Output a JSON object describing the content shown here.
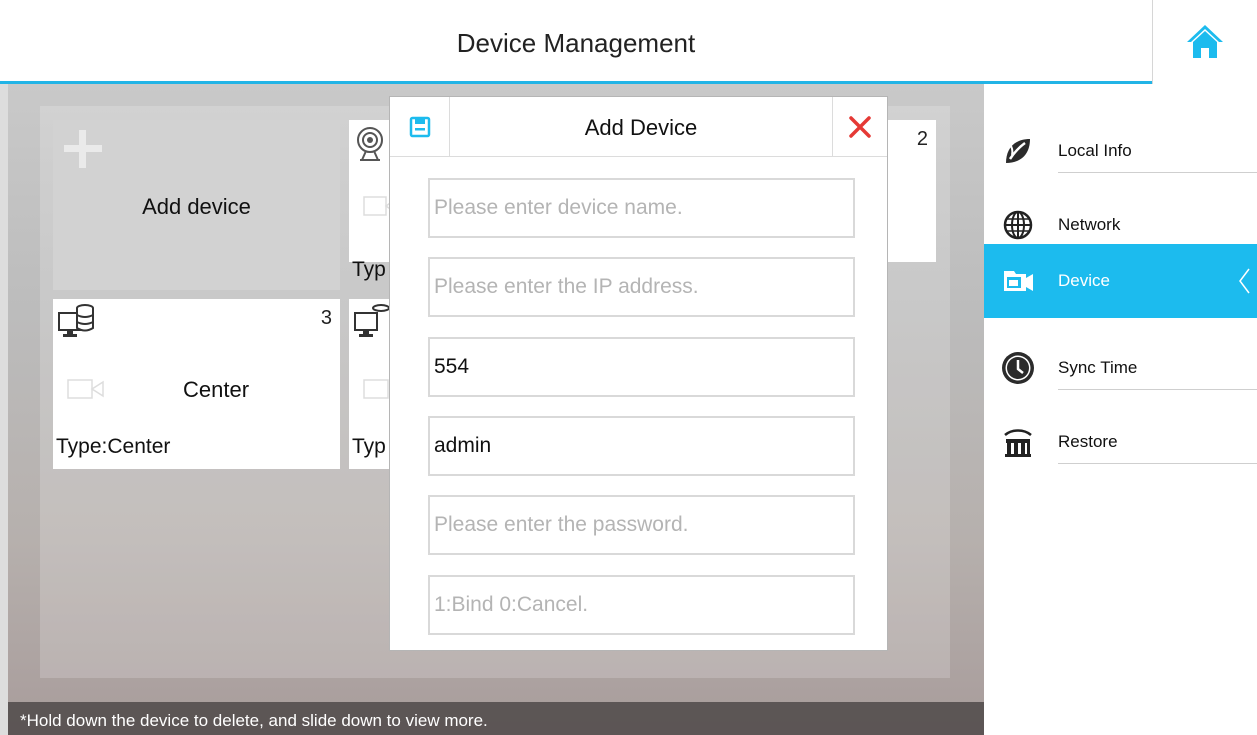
{
  "header": {
    "title": "Device Management",
    "home_icon": "home-icon"
  },
  "accent_color": "#1cbbee",
  "devices": {
    "add_label": "Add device",
    "card_top_right": {
      "num": "2",
      "type_label": "Typ"
    },
    "card_center": {
      "num": "3",
      "name": "Center",
      "type_label": "Type:Center"
    },
    "card_bottom_right": {
      "type_label": "Typ"
    }
  },
  "footer": {
    "hint": "*Hold down the device to delete, and slide down to view more."
  },
  "sidebar": {
    "items": [
      {
        "label": "Local Info",
        "icon": "leaf-icon"
      },
      {
        "label": "Network",
        "icon": "globe-icon"
      },
      {
        "label": "Device",
        "icon": "device-camera-icon",
        "active": true
      },
      {
        "label": "Sync Time",
        "icon": "clock-icon"
      },
      {
        "label": "Restore",
        "icon": "restore-icon"
      }
    ]
  },
  "modal": {
    "title": "Add Device",
    "save_icon": "save-icon",
    "close_icon": "close-icon",
    "fields": [
      {
        "placeholder": "Please enter device name.",
        "value": ""
      },
      {
        "placeholder": "Please enter the IP address.",
        "value": ""
      },
      {
        "placeholder": "",
        "value": "554"
      },
      {
        "placeholder": "",
        "value": "admin"
      },
      {
        "placeholder": "Please enter the password.",
        "value": ""
      },
      {
        "placeholder": "1:Bind 0:Cancel.",
        "value": ""
      }
    ]
  }
}
